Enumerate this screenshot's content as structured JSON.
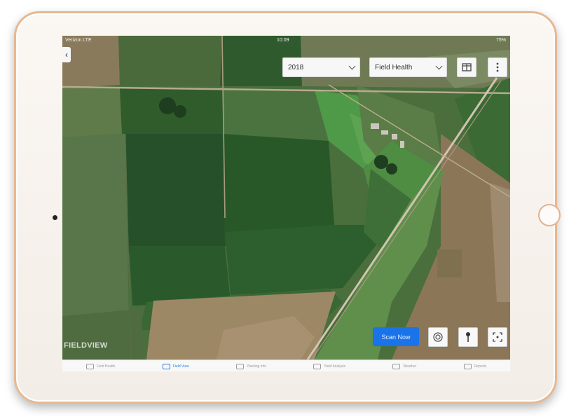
{
  "status_bar": {
    "carrier": "Verizon LTE",
    "time": "10:09",
    "battery": "75%"
  },
  "controls": {
    "year_select": {
      "value": "2018"
    },
    "layer_select": {
      "value": "Field Health"
    },
    "scan_button_label": "Scan Now",
    "logo_text": "FIELDVIEW"
  },
  "icons": {
    "back": "chevron-left-icon",
    "layout": "split-view-icon",
    "more": "vertical-ellipsis-icon",
    "location": "location-target-icon",
    "pin": "map-pin-icon",
    "fullscreen": "fullscreen-icon"
  },
  "tabs": [
    {
      "label": "Field Health"
    },
    {
      "label": "Field View"
    },
    {
      "label": "Planting Info"
    },
    {
      "label": "Yield Analysis"
    },
    {
      "label": "Weather"
    },
    {
      "label": "Reports"
    }
  ],
  "colors": {
    "accent": "#1a73e8",
    "frame_gold": "#e6b892"
  }
}
